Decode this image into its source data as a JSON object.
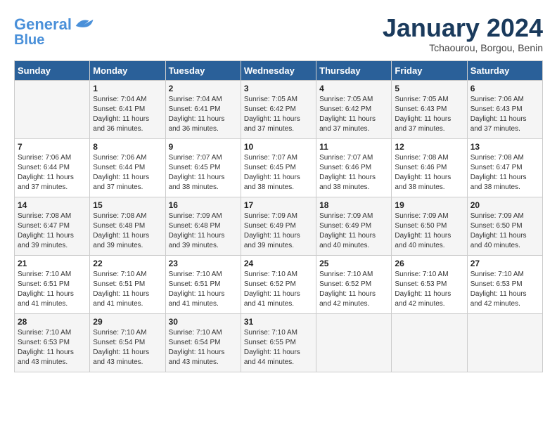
{
  "header": {
    "logo_line1": "General",
    "logo_line2": "Blue",
    "title": "January 2024",
    "subtitle": "Tchaourou, Borgou, Benin"
  },
  "days_of_week": [
    "Sunday",
    "Monday",
    "Tuesday",
    "Wednesday",
    "Thursday",
    "Friday",
    "Saturday"
  ],
  "weeks": [
    [
      {
        "day": "",
        "sunrise": "",
        "sunset": "",
        "daylight": ""
      },
      {
        "day": "1",
        "sunrise": "Sunrise: 7:04 AM",
        "sunset": "Sunset: 6:41 PM",
        "daylight": "Daylight: 11 hours and 36 minutes."
      },
      {
        "day": "2",
        "sunrise": "Sunrise: 7:04 AM",
        "sunset": "Sunset: 6:41 PM",
        "daylight": "Daylight: 11 hours and 36 minutes."
      },
      {
        "day": "3",
        "sunrise": "Sunrise: 7:05 AM",
        "sunset": "Sunset: 6:42 PM",
        "daylight": "Daylight: 11 hours and 37 minutes."
      },
      {
        "day": "4",
        "sunrise": "Sunrise: 7:05 AM",
        "sunset": "Sunset: 6:42 PM",
        "daylight": "Daylight: 11 hours and 37 minutes."
      },
      {
        "day": "5",
        "sunrise": "Sunrise: 7:05 AM",
        "sunset": "Sunset: 6:43 PM",
        "daylight": "Daylight: 11 hours and 37 minutes."
      },
      {
        "day": "6",
        "sunrise": "Sunrise: 7:06 AM",
        "sunset": "Sunset: 6:43 PM",
        "daylight": "Daylight: 11 hours and 37 minutes."
      }
    ],
    [
      {
        "day": "7",
        "sunrise": "Sunrise: 7:06 AM",
        "sunset": "Sunset: 6:44 PM",
        "daylight": "Daylight: 11 hours and 37 minutes."
      },
      {
        "day": "8",
        "sunrise": "Sunrise: 7:06 AM",
        "sunset": "Sunset: 6:44 PM",
        "daylight": "Daylight: 11 hours and 37 minutes."
      },
      {
        "day": "9",
        "sunrise": "Sunrise: 7:07 AM",
        "sunset": "Sunset: 6:45 PM",
        "daylight": "Daylight: 11 hours and 38 minutes."
      },
      {
        "day": "10",
        "sunrise": "Sunrise: 7:07 AM",
        "sunset": "Sunset: 6:45 PM",
        "daylight": "Daylight: 11 hours and 38 minutes."
      },
      {
        "day": "11",
        "sunrise": "Sunrise: 7:07 AM",
        "sunset": "Sunset: 6:46 PM",
        "daylight": "Daylight: 11 hours and 38 minutes."
      },
      {
        "day": "12",
        "sunrise": "Sunrise: 7:08 AM",
        "sunset": "Sunset: 6:46 PM",
        "daylight": "Daylight: 11 hours and 38 minutes."
      },
      {
        "day": "13",
        "sunrise": "Sunrise: 7:08 AM",
        "sunset": "Sunset: 6:47 PM",
        "daylight": "Daylight: 11 hours and 38 minutes."
      }
    ],
    [
      {
        "day": "14",
        "sunrise": "Sunrise: 7:08 AM",
        "sunset": "Sunset: 6:47 PM",
        "daylight": "Daylight: 11 hours and 39 minutes."
      },
      {
        "day": "15",
        "sunrise": "Sunrise: 7:08 AM",
        "sunset": "Sunset: 6:48 PM",
        "daylight": "Daylight: 11 hours and 39 minutes."
      },
      {
        "day": "16",
        "sunrise": "Sunrise: 7:09 AM",
        "sunset": "Sunset: 6:48 PM",
        "daylight": "Daylight: 11 hours and 39 minutes."
      },
      {
        "day": "17",
        "sunrise": "Sunrise: 7:09 AM",
        "sunset": "Sunset: 6:49 PM",
        "daylight": "Daylight: 11 hours and 39 minutes."
      },
      {
        "day": "18",
        "sunrise": "Sunrise: 7:09 AM",
        "sunset": "Sunset: 6:49 PM",
        "daylight": "Daylight: 11 hours and 40 minutes."
      },
      {
        "day": "19",
        "sunrise": "Sunrise: 7:09 AM",
        "sunset": "Sunset: 6:50 PM",
        "daylight": "Daylight: 11 hours and 40 minutes."
      },
      {
        "day": "20",
        "sunrise": "Sunrise: 7:09 AM",
        "sunset": "Sunset: 6:50 PM",
        "daylight": "Daylight: 11 hours and 40 minutes."
      }
    ],
    [
      {
        "day": "21",
        "sunrise": "Sunrise: 7:10 AM",
        "sunset": "Sunset: 6:51 PM",
        "daylight": "Daylight: 11 hours and 41 minutes."
      },
      {
        "day": "22",
        "sunrise": "Sunrise: 7:10 AM",
        "sunset": "Sunset: 6:51 PM",
        "daylight": "Daylight: 11 hours and 41 minutes."
      },
      {
        "day": "23",
        "sunrise": "Sunrise: 7:10 AM",
        "sunset": "Sunset: 6:51 PM",
        "daylight": "Daylight: 11 hours and 41 minutes."
      },
      {
        "day": "24",
        "sunrise": "Sunrise: 7:10 AM",
        "sunset": "Sunset: 6:52 PM",
        "daylight": "Daylight: 11 hours and 41 minutes."
      },
      {
        "day": "25",
        "sunrise": "Sunrise: 7:10 AM",
        "sunset": "Sunset: 6:52 PM",
        "daylight": "Daylight: 11 hours and 42 minutes."
      },
      {
        "day": "26",
        "sunrise": "Sunrise: 7:10 AM",
        "sunset": "Sunset: 6:53 PM",
        "daylight": "Daylight: 11 hours and 42 minutes."
      },
      {
        "day": "27",
        "sunrise": "Sunrise: 7:10 AM",
        "sunset": "Sunset: 6:53 PM",
        "daylight": "Daylight: 11 hours and 42 minutes."
      }
    ],
    [
      {
        "day": "28",
        "sunrise": "Sunrise: 7:10 AM",
        "sunset": "Sunset: 6:53 PM",
        "daylight": "Daylight: 11 hours and 43 minutes."
      },
      {
        "day": "29",
        "sunrise": "Sunrise: 7:10 AM",
        "sunset": "Sunset: 6:54 PM",
        "daylight": "Daylight: 11 hours and 43 minutes."
      },
      {
        "day": "30",
        "sunrise": "Sunrise: 7:10 AM",
        "sunset": "Sunset: 6:54 PM",
        "daylight": "Daylight: 11 hours and 43 minutes."
      },
      {
        "day": "31",
        "sunrise": "Sunrise: 7:10 AM",
        "sunset": "Sunset: 6:55 PM",
        "daylight": "Daylight: 11 hours and 44 minutes."
      },
      {
        "day": "",
        "sunrise": "",
        "sunset": "",
        "daylight": ""
      },
      {
        "day": "",
        "sunrise": "",
        "sunset": "",
        "daylight": ""
      },
      {
        "day": "",
        "sunrise": "",
        "sunset": "",
        "daylight": ""
      }
    ]
  ]
}
